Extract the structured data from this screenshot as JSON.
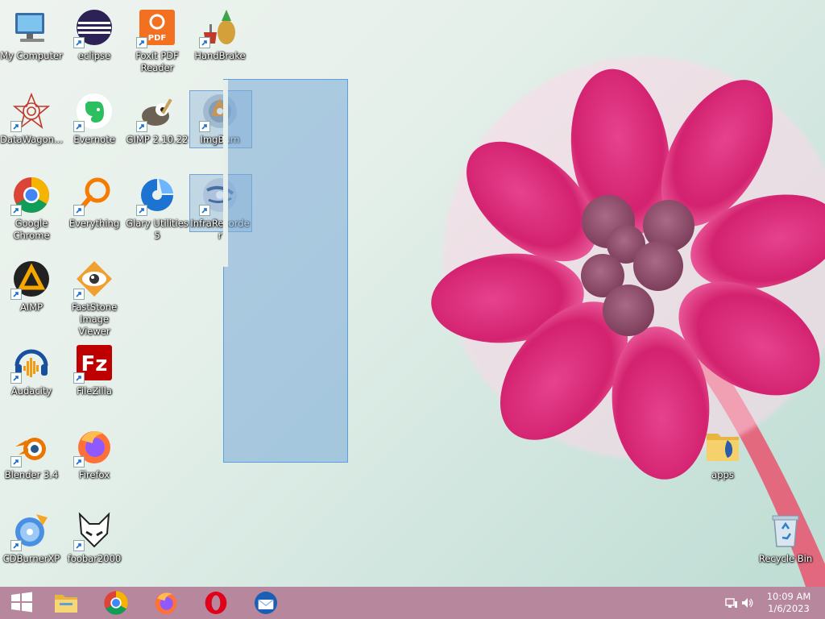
{
  "desktop": {
    "icons": [
      {
        "label": "My Computer"
      },
      {
        "label": "eclipse"
      },
      {
        "label": "Foxit PDF Reader"
      },
      {
        "label": "HandBrake"
      },
      {
        "label": "DataWagon..."
      },
      {
        "label": "Evernote"
      },
      {
        "label": "GIMP 2.10.22"
      },
      {
        "label": "ImgBurn"
      },
      {
        "label": "Google Chrome"
      },
      {
        "label": "Everything"
      },
      {
        "label": "Glary Utilities 5"
      },
      {
        "label": "InfraRecorder"
      },
      {
        "label": "AIMP"
      },
      {
        "label": "FastStone Image Viewer"
      },
      {
        "label": "Audacity"
      },
      {
        "label": "FileZilla"
      },
      {
        "label": "Blender 3.4"
      },
      {
        "label": "Firefox"
      },
      {
        "label": "CDBurnerXP"
      },
      {
        "label": "foobar2000"
      },
      {
        "label": "apps"
      },
      {
        "label": "Recycle Bin"
      }
    ]
  },
  "taskbar": {
    "pinned": [
      "start-icon",
      "file-explorer-icon",
      "chrome-icon",
      "firefox-icon",
      "opera-icon",
      "thunderbird-icon"
    ],
    "clock_time": "10:09 AM",
    "clock_date": "1/6/2023",
    "accent": "#b7879e"
  }
}
